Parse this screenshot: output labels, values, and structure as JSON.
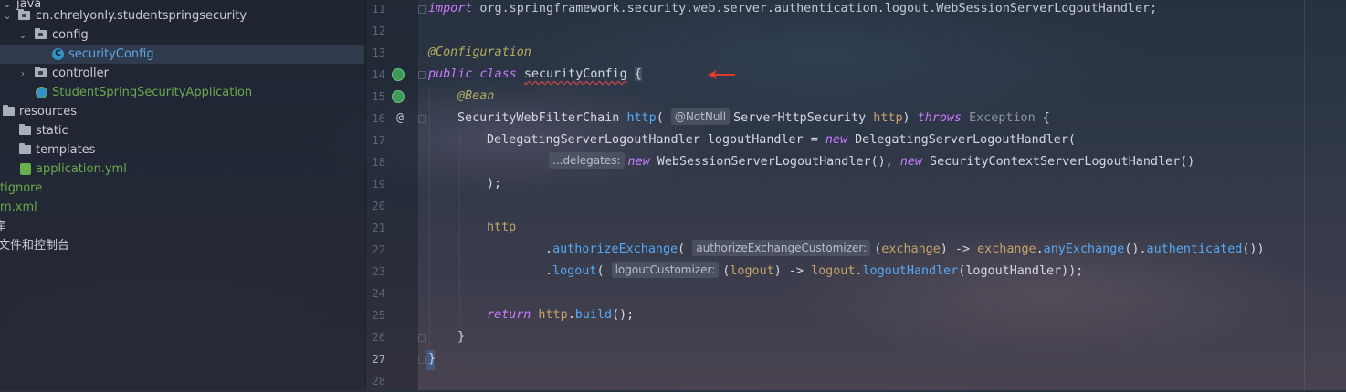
{
  "project_tree": {
    "rows": [
      {
        "label": "java"
      },
      {
        "label": "cn.chrelyonly.studentspringsecurity"
      },
      {
        "label": "config"
      },
      {
        "label": "securityConfig"
      },
      {
        "label": "controller"
      },
      {
        "label": "StudentSpringSecurityApplication"
      },
      {
        "label": "resources"
      },
      {
        "label": "static"
      },
      {
        "label": "templates"
      },
      {
        "label": "application.yml"
      },
      {
        "label": "tignore"
      },
      {
        "label": "m.xml"
      },
      {
        "label": "库"
      },
      {
        "label": "文件和控制台"
      }
    ]
  },
  "editor": {
    "line_numbers": [
      "11",
      "12",
      "13",
      "14",
      "15",
      "16",
      "17",
      "18",
      "19",
      "20",
      "21",
      "22",
      "23",
      "24",
      "25",
      "26",
      "27",
      "28"
    ],
    "hints": {
      "delegates": "...delegates:",
      "notnull": "@NotNull",
      "authorize": "authorizeExchangeCustomizer:",
      "logout": "logoutCustomizer:"
    },
    "tokens": {
      "import_kw": "import",
      "import_path": " org.springframework.security.web.server.authentication.logout.WebSessionServerLogoutHandler;",
      "configuration": "@Configuration",
      "public_kw": "public",
      "class_kw": "class",
      "class_name": "securityConfig",
      "open_brace": "{",
      "bean": "@Bean",
      "sec_chain": "SecurityWebFilterChain",
      "http_method": "http",
      "paren_open": "(",
      "server_http": "ServerHttpSecurity",
      "http_param": "http",
      "paren_close_sp": ") ",
      "throws_kw": "throws",
      "exception": "Exception",
      "brace_open_sp": " {",
      "deleg_type": "DelegatingServerLogoutHandler logoutHandler = ",
      "new_kw": "new",
      "deleg_ctor": " DelegatingServerLogoutHandler(",
      "websession": " WebSessionServerLogoutHandler(), ",
      "sec_ctx": " SecurityContextServerLogoutHandler()",
      "close_stmt": ");",
      "http_word": "http",
      "dot": ".",
      "authorize_exchange": "authorizeExchange",
      "exchange_param": "exchange",
      "arrow_sp": ") -> ",
      "exchange_var": "exchange",
      "any_exchange": "anyExchange",
      "paren_dot": "().",
      "authenticated": "authenticated",
      "double_close": "())",
      "logout_method": "logout",
      "logout_param": "logout",
      "logout_var": "logout",
      "logout_handler": "logoutHandler",
      "logout_handler_arg": "(logoutHandler));",
      "return_kw": "return",
      "http_build_obj": " http",
      "build": "build",
      "build_close": "();",
      "close_brace": "}",
      "final_brace": "}"
    }
  },
  "colors": {
    "keyword": "#cf8e6d",
    "import_keyword": "#cc7aff",
    "annotation": "#b3ae60",
    "method": "#56a8f5",
    "parameter": "#c9a36a",
    "tree_green": "#6aa84f",
    "tree_blue": "#5fa5e0",
    "arrow": "#e03a2a"
  },
  "icons": {
    "spring_bean_gutter": "spring-bean-icon",
    "spring_bean_link_gutter": "spring-bean-link-icon",
    "override_at_gutter": "at-annotation-icon",
    "red_arrow": "red-arrow-annotation-icon"
  }
}
